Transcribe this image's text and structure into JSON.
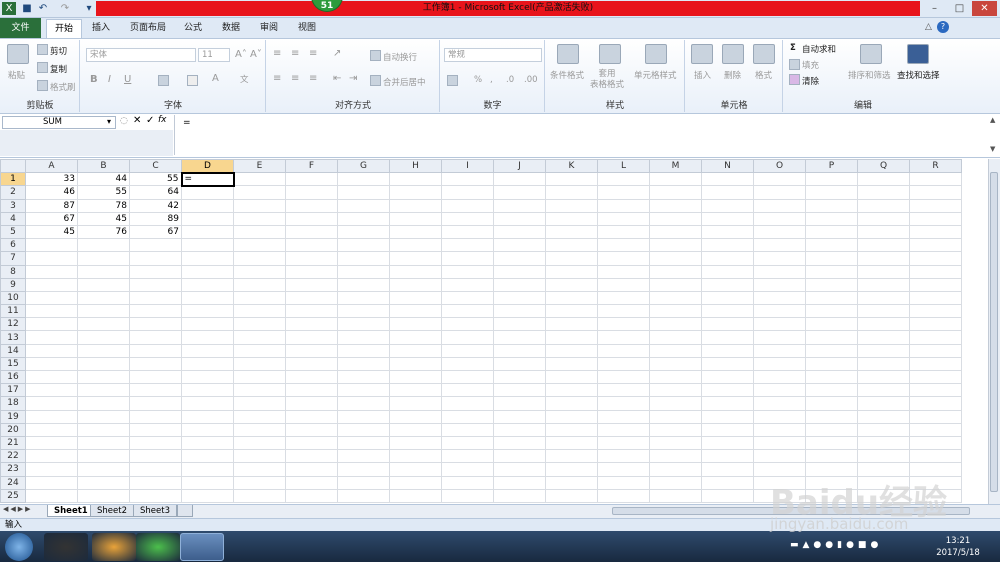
{
  "title_bar": {
    "badge": "51",
    "title": "工作簿1 - Microsoft Excel(产品激活失败)"
  },
  "tabs": [
    {
      "label": "文件"
    },
    {
      "label": "开始"
    },
    {
      "label": "插入"
    },
    {
      "label": "页面布局"
    },
    {
      "label": "公式"
    },
    {
      "label": "数据"
    },
    {
      "label": "审阅"
    },
    {
      "label": "视图"
    }
  ],
  "ribbon": {
    "clipboard": {
      "paste": "粘贴",
      "cut": "剪切",
      "copy": "复制",
      "format_painter": "格式刷",
      "label": "剪贴板"
    },
    "font": {
      "name": "宋体",
      "size": "11",
      "label": "字体"
    },
    "alignment": {
      "wrap": "自动换行",
      "merge": "合并后居中",
      "label": "对齐方式"
    },
    "number": {
      "format": "常规",
      "label": "数字"
    },
    "styles": {
      "conditional": "条件格式",
      "table": "套用\n表格格式",
      "cell_styles": "单元格样式",
      "label": "样式"
    },
    "cells": {
      "insert": "插入",
      "delete": "删除",
      "format": "格式",
      "label": "单元格"
    },
    "editing": {
      "autosum": "自动求和",
      "fill": "填充",
      "clear": "清除",
      "sort": "排序和筛选",
      "find": "查找和选择",
      "label": "编辑"
    }
  },
  "formula_bar": {
    "name_box": "SUM",
    "formula": "="
  },
  "columns": [
    "A",
    "B",
    "C",
    "D",
    "E",
    "F",
    "G",
    "H",
    "I",
    "J",
    "K",
    "L",
    "M",
    "N",
    "O",
    "P",
    "Q",
    "R"
  ],
  "rows": [
    [
      "33",
      "44",
      "55",
      "="
    ],
    [
      "46",
      "55",
      "64"
    ],
    [
      "87",
      "78",
      "42"
    ],
    [
      "67",
      "45",
      "89"
    ],
    [
      "45",
      "76",
      "67"
    ]
  ],
  "row_count": 25,
  "active_cell": "D1",
  "sheets": [
    "Sheet1",
    "Sheet2",
    "Sheet3"
  ],
  "status": "输入",
  "clock": {
    "time": "13:21",
    "date": "2017/5/18"
  },
  "watermark": {
    "brand": "Baidu经验",
    "url": "jingyan.baidu.com"
  }
}
